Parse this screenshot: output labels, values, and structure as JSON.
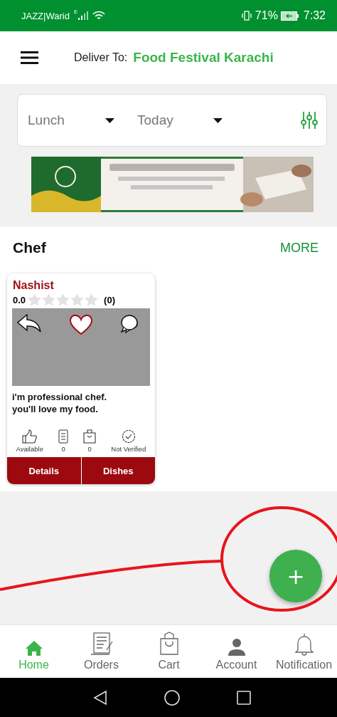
{
  "status_bar": {
    "carrier": "JAZZ|Warid",
    "network": "E",
    "battery": "71%",
    "time": "7:32"
  },
  "header": {
    "deliver_label": "Deliver To:",
    "location": "Food Festival Karachi"
  },
  "filters": [
    {
      "label": "Lunch"
    },
    {
      "label": "Today"
    }
  ],
  "section": {
    "title": "Chef",
    "more": "MORE"
  },
  "chefs": [
    {
      "name": "Nashist",
      "rating": "0.0",
      "stars": 0,
      "reviews": "(0)",
      "bio": "i'm professional chef.\nyou'll love my food.",
      "stats": [
        {
          "kind": "availability",
          "label": "Available"
        },
        {
          "kind": "menu",
          "label": "0"
        },
        {
          "kind": "bag",
          "label": "0"
        },
        {
          "kind": "verified",
          "label": "Not Verified"
        }
      ],
      "buttons": [
        "Details",
        "Dishes"
      ]
    }
  ],
  "fab": {
    "label": "+"
  },
  "nav": [
    {
      "kind": "home",
      "label": "Home",
      "selected": true
    },
    {
      "kind": "orders",
      "label": "Orders",
      "selected": false
    },
    {
      "kind": "cart",
      "label": "Cart",
      "selected": false
    },
    {
      "kind": "account",
      "label": "Account",
      "selected": false
    },
    {
      "kind": "bell",
      "label": "Notification",
      "selected": false
    }
  ]
}
